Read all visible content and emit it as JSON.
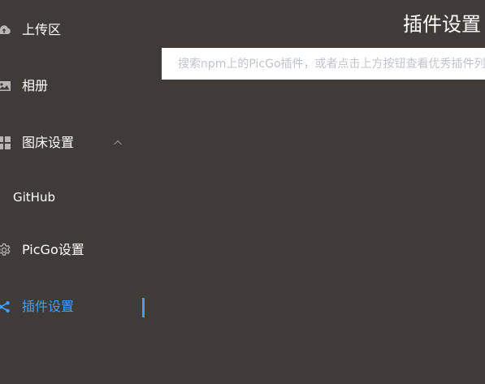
{
  "sidebar": {
    "items": [
      {
        "label": "上传区",
        "icon": "cloud-upload-icon"
      },
      {
        "label": "相册",
        "icon": "picture-icon"
      },
      {
        "label": "图床设置",
        "icon": "grid-icon",
        "expanded": true,
        "children": [
          {
            "label": "GitHub"
          }
        ]
      },
      {
        "label": "PicGo设置",
        "icon": "gear-icon"
      },
      {
        "label": "插件设置",
        "icon": "share-icon",
        "active": true
      }
    ]
  },
  "main": {
    "title": "插件设置",
    "search": {
      "value": "",
      "placeholder": "搜索npm上的PicGo插件，或者点击上方按钮查看优秀插件列表"
    }
  },
  "colors": {
    "background": "#3f3c37",
    "text": "#ffffff",
    "accent": "#409eff"
  }
}
